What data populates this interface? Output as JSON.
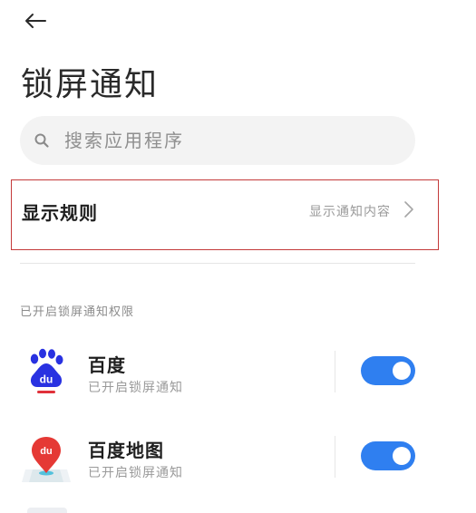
{
  "header": {
    "back_icon": "arrow-left-icon",
    "title": "锁屏通知"
  },
  "search": {
    "placeholder": "搜索应用程序",
    "value": "",
    "icon": "search-icon"
  },
  "display_rule": {
    "label": "显示规则",
    "value": "显示通知内容",
    "icon": "chevron-right-icon"
  },
  "section": {
    "header": "已开启锁屏通知权限"
  },
  "apps": [
    {
      "name": "百度",
      "status": "已开启锁屏通知",
      "icon": "baidu-paw-icon",
      "enabled": true
    },
    {
      "name": "百度地图",
      "status": "已开启锁屏通知",
      "icon": "baidu-map-icon",
      "enabled": true
    }
  ],
  "colors": {
    "accent": "#2f7ff0",
    "highlight_border": "#c43a3a",
    "baidu_blue": "#2932e1",
    "baidu_red": "#e0313a"
  }
}
